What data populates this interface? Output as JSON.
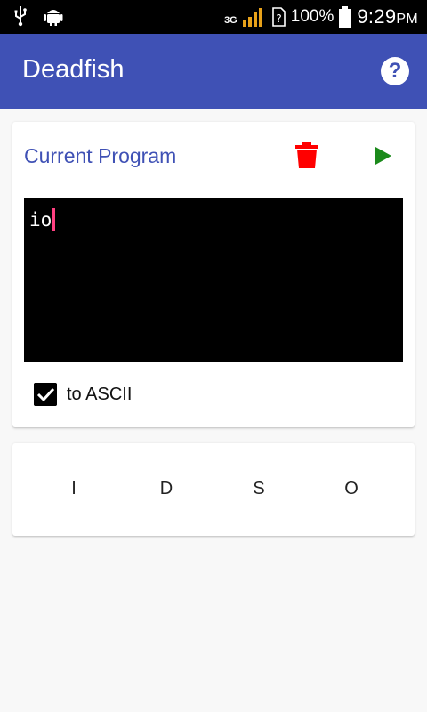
{
  "status_bar": {
    "network": "3G",
    "battery": "100%",
    "time": "9:29",
    "ampm": "PM"
  },
  "app_bar": {
    "title": "Deadfish",
    "help_icon": "help-circle-icon"
  },
  "program_card": {
    "title": "Current Program",
    "delete_icon": "trash-icon",
    "run_icon": "play-icon",
    "code": "io",
    "ascii_checkbox": {
      "label": "to ASCII",
      "checked": true
    }
  },
  "keys": [
    "I",
    "D",
    "S",
    "O"
  ],
  "colors": {
    "primary": "#3f51b5",
    "delete": "#ff0000",
    "run": "#1b8a1b",
    "cursor": "#ff4081"
  }
}
